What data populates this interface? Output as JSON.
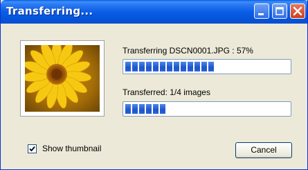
{
  "window": {
    "title": "Transferring..."
  },
  "transfer": {
    "file_status": "Transferring DSCN0001.JPG : 57%",
    "file_progress": 0.57,
    "images_status": "Transferred: 1/4 images",
    "images_progress": 0.25
  },
  "options": {
    "show_thumbnail_label": "Show thumbnail",
    "show_thumbnail_checked": true
  },
  "actions": {
    "cancel_label": "Cancel"
  },
  "colors": {
    "titlebar": "#0a5ee6",
    "progress_fill": "#2c62d8",
    "dialog_bg": "#ece9d8"
  }
}
